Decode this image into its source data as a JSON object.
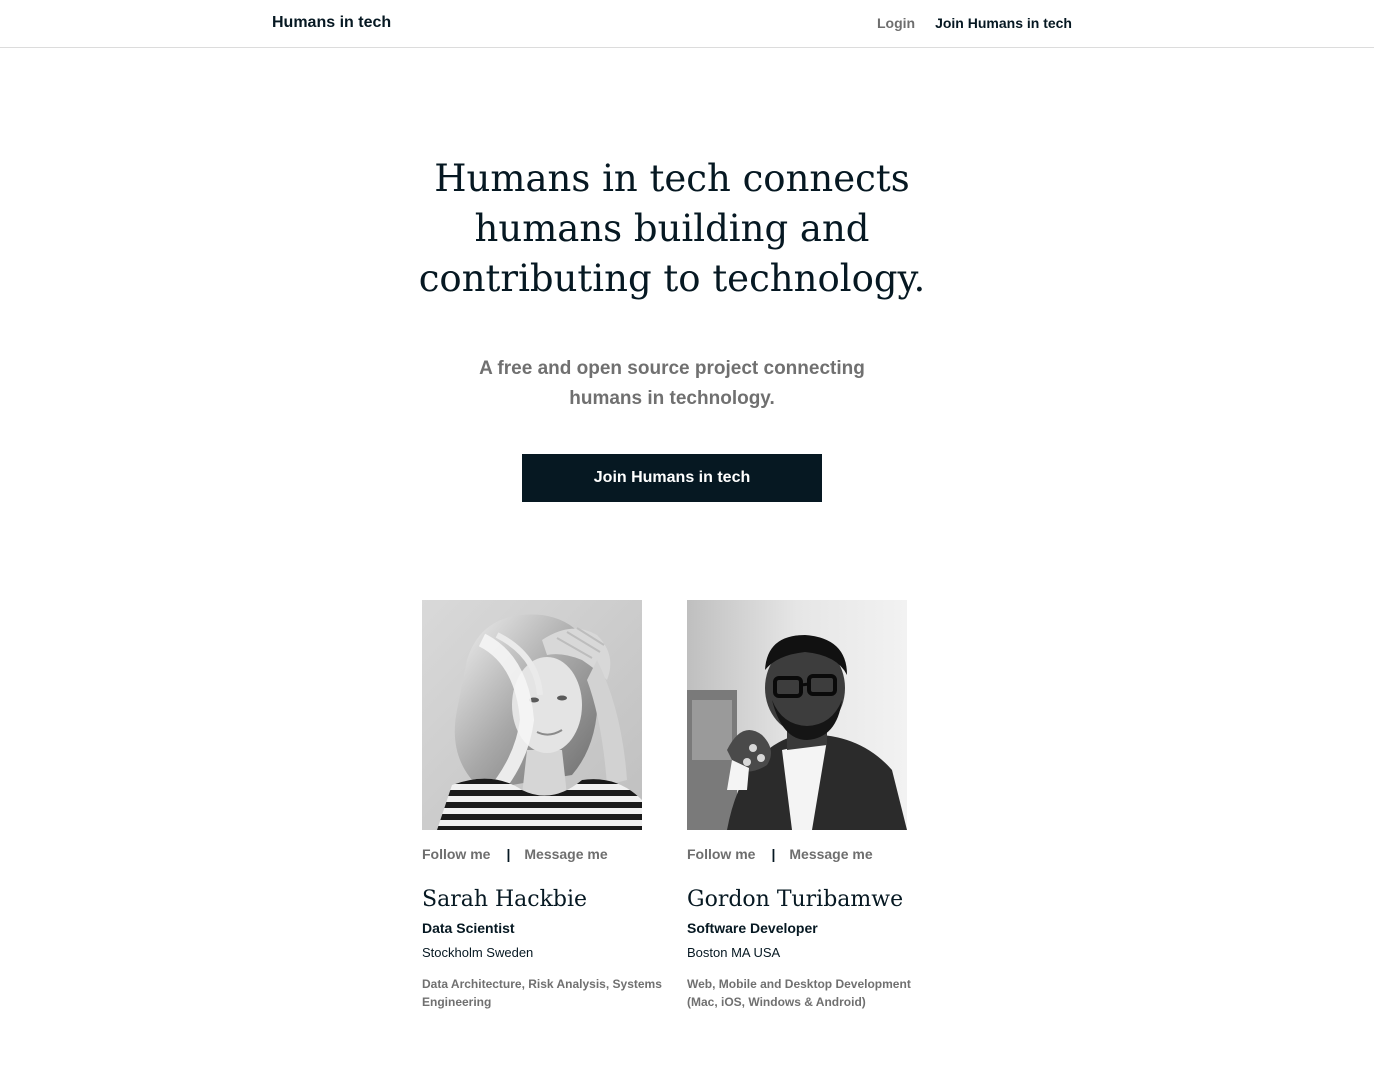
{
  "header": {
    "brand": "Humans in tech",
    "login": "Login",
    "join": "Join Humans in tech"
  },
  "hero": {
    "title": "Humans in tech connects humans building and contributing to technology.",
    "subtitle": "A free and open source project connecting humans in technology.",
    "cta": "Join Humans in tech"
  },
  "profiles": [
    {
      "follow": "Follow me",
      "separator": "|",
      "message": "Message me",
      "name": "Sarah Hackbie",
      "role": "Data Scientist",
      "location": "Stockholm Sweden",
      "skills": "Data Architecture, Risk Analysis, Systems Engineering"
    },
    {
      "follow": "Follow me",
      "separator": "|",
      "message": "Message me",
      "name": "Gordon Turibamwe",
      "role": "Software Developer",
      "location": "Boston MA USA",
      "skills": "Web, Mobile and Desktop Development (Mac, iOS, Windows & Android)"
    }
  ]
}
